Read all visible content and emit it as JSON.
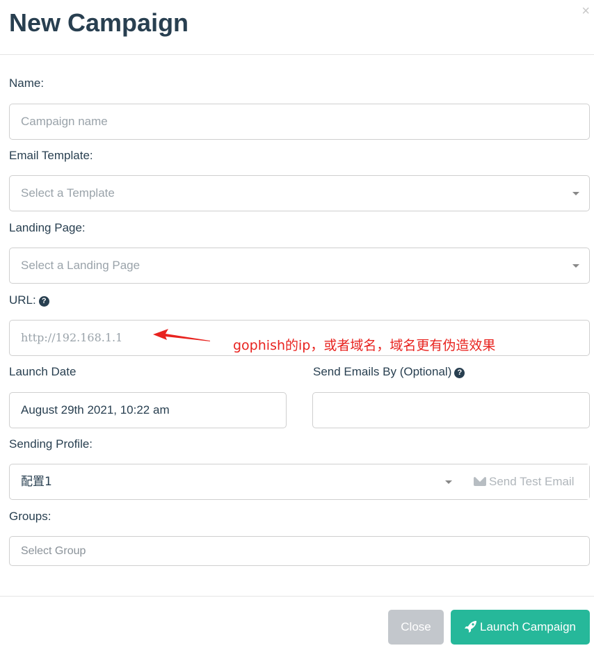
{
  "modal": {
    "title": "New Campaign",
    "close_symbol": "×"
  },
  "form": {
    "name_label": "Name:",
    "name_placeholder": "Campaign name",
    "template_label": "Email Template:",
    "template_placeholder": "Select a Template",
    "landing_label": "Landing Page:",
    "landing_placeholder": "Select a Landing Page",
    "url_label": "URL:",
    "url_placeholder": "http://192.168.1.1",
    "launch_date_label": "Launch Date",
    "launch_date_value": "August 29th 2021, 10:22 am",
    "send_by_label": "Send Emails By (Optional)",
    "send_by_value": "",
    "profile_label": "Sending Profile:",
    "profile_value": "配置1",
    "send_test_label": "Send Test Email",
    "groups_label": "Groups:",
    "groups_placeholder": "Select Group"
  },
  "annotation": {
    "text": "gophish的ip，或者域名，域名更有伪造效果",
    "color": "#e8231f"
  },
  "footer": {
    "close_label": "Close",
    "launch_label": "Launch Campaign"
  },
  "colors": {
    "accent": "#26b89a",
    "heading": "#283f50",
    "disabled_button": "#c3c7cc"
  }
}
